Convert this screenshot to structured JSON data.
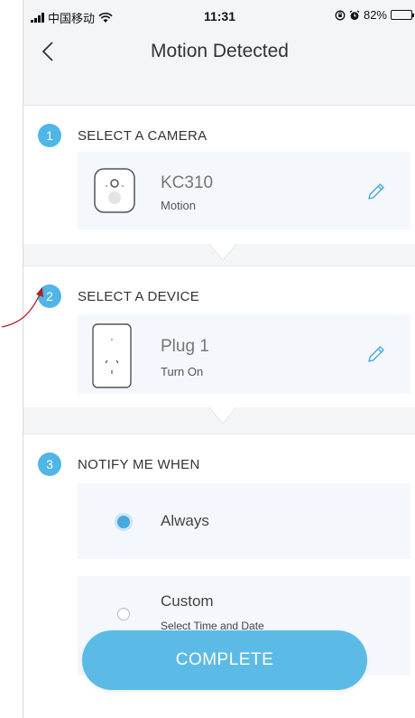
{
  "status_bar": {
    "carrier": "中国移动",
    "time": "11:31",
    "battery": "82%",
    "battery_level": 0.82
  },
  "nav": {
    "title": "Motion Detected"
  },
  "steps": [
    {
      "number": "1",
      "label": "SELECT A CAMERA",
      "card": {
        "name": "KC310",
        "sub": "Motion"
      }
    },
    {
      "number": "2",
      "label": "SELECT A DEVICE",
      "card": {
        "name": "Plug 1",
        "sub": "Turn On"
      }
    },
    {
      "number": "3",
      "label": "NOTIFY ME WHEN",
      "options": [
        {
          "label": "Always",
          "selected": true
        },
        {
          "label": "Custom",
          "sub": "Select Time and Date",
          "selected": false
        }
      ]
    }
  ],
  "complete_button": "COMPLETE",
  "colors": {
    "accent": "#4fb6e6",
    "button": "#5bbbe6",
    "annotation": "#b0202a"
  }
}
